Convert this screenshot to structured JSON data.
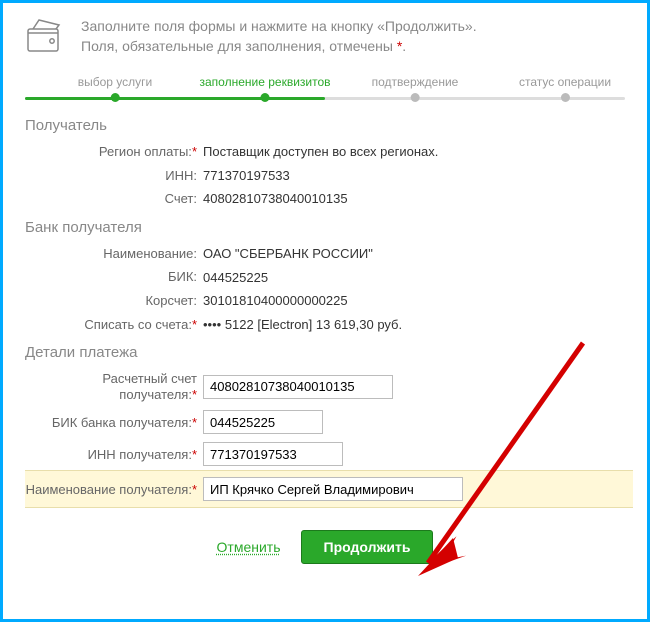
{
  "header": {
    "line1": "Заполните поля формы и нажмите на кнопку «Продолжить».",
    "line2_a": "Поля, обязательные для заполнения, отмечены ",
    "line2_b": "."
  },
  "steps": [
    {
      "label": "выбор услуги",
      "pos": 15,
      "state": "done"
    },
    {
      "label": "заполнение реквизитов",
      "pos": 40,
      "state": "active"
    },
    {
      "label": "подтверждение",
      "pos": 65,
      "state": ""
    },
    {
      "label": "статус операции",
      "pos": 90,
      "state": ""
    }
  ],
  "sections": {
    "recipient_title": "Получатель",
    "bank_title": "Банк получателя",
    "details_title": "Детали платежа"
  },
  "fields": {
    "region_label": "Регион оплаты:",
    "region_value": "Поставщик доступен во всех регионах.",
    "inn_label": "ИНН:",
    "inn_value": "771370197533",
    "acct_label": "Счет:",
    "acct_value": "40802810738040010135",
    "bank_name_label": "Наименование:",
    "bank_name_value": "ОАО \"СБЕРБАНК РОССИИ\"",
    "bik_label": "БИК:",
    "bik_value": "044525225",
    "coracct_label": "Корсчет:",
    "coracct_value": "30101810400000000225",
    "from_acct_label": "Списать со счета:",
    "from_acct_value": "•••• 5122  [Electron] 13 619,30  руб.",
    "settle_label": "Расчетный счет получателя:",
    "settle_value": "40802810738040010135",
    "bikrecv_label": "БИК банка получателя:",
    "bikrecv_value": "044525225",
    "innrecv_label": "ИНН получателя:",
    "innrecv_value": "771370197533",
    "recvname_label": "Наименование получателя:",
    "recvname_value": "ИП Крячко Сергей Владимирович"
  },
  "actions": {
    "cancel": "Отменить",
    "continue": "Продолжить"
  },
  "colors": {
    "accent": "#2aa82a",
    "border": "#00aaff",
    "arrow": "#d40000"
  }
}
